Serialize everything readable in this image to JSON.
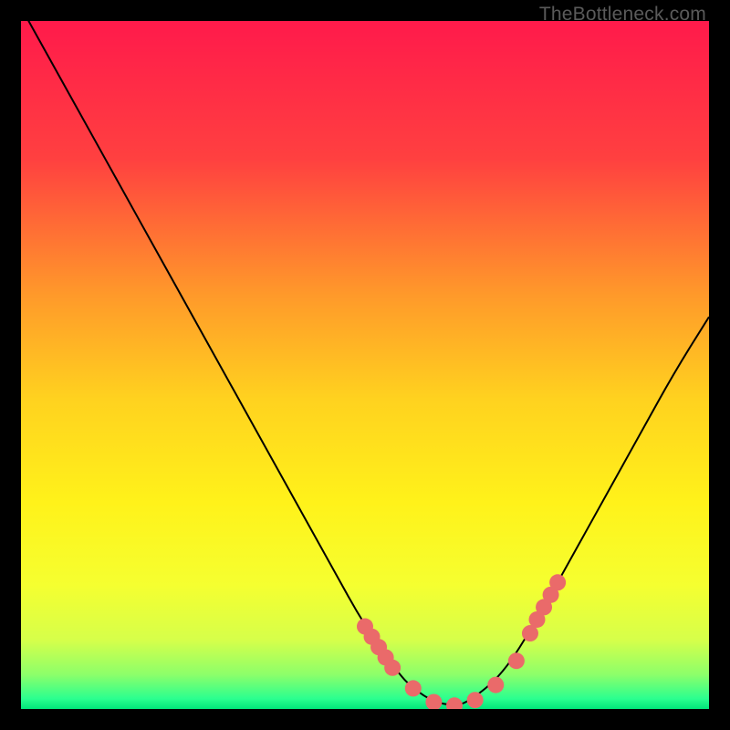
{
  "watermark": "TheBottleneck.com",
  "chart_data": {
    "type": "line",
    "title": "",
    "xlabel": "",
    "ylabel": "",
    "xlim": [
      0,
      100
    ],
    "ylim": [
      0,
      100
    ],
    "x": [
      0,
      5,
      10,
      15,
      20,
      25,
      30,
      35,
      40,
      45,
      50,
      55,
      57,
      60,
      63,
      65,
      70,
      75,
      80,
      85,
      90,
      95,
      100
    ],
    "values": [
      102,
      93,
      84,
      75,
      66,
      57,
      48,
      39,
      30,
      21,
      12,
      5,
      3,
      1,
      0.5,
      1,
      5,
      13,
      22,
      31,
      40,
      49,
      57
    ],
    "highlighted_zone_y": [
      0,
      20
    ],
    "markers": {
      "x": [
        50,
        51,
        52,
        53,
        54,
        57,
        60,
        63,
        66,
        69,
        72,
        74,
        75,
        76,
        77,
        78
      ],
      "y": [
        12,
        10.5,
        9,
        7.5,
        6,
        3,
        1,
        0.5,
        1.3,
        3.5,
        7,
        11,
        13,
        14.8,
        16.6,
        18.4
      ]
    },
    "gradient_stops": [
      {
        "offset": 0.0,
        "color": "#ff1a4b"
      },
      {
        "offset": 0.2,
        "color": "#ff4040"
      },
      {
        "offset": 0.4,
        "color": "#ff9a2a"
      },
      {
        "offset": 0.55,
        "color": "#ffd21f"
      },
      {
        "offset": 0.7,
        "color": "#fff21a"
      },
      {
        "offset": 0.82,
        "color": "#f5ff30"
      },
      {
        "offset": 0.9,
        "color": "#d6ff4a"
      },
      {
        "offset": 0.95,
        "color": "#8cff6a"
      },
      {
        "offset": 0.985,
        "color": "#2bff8f"
      },
      {
        "offset": 1.0,
        "color": "#00e57a"
      }
    ]
  }
}
